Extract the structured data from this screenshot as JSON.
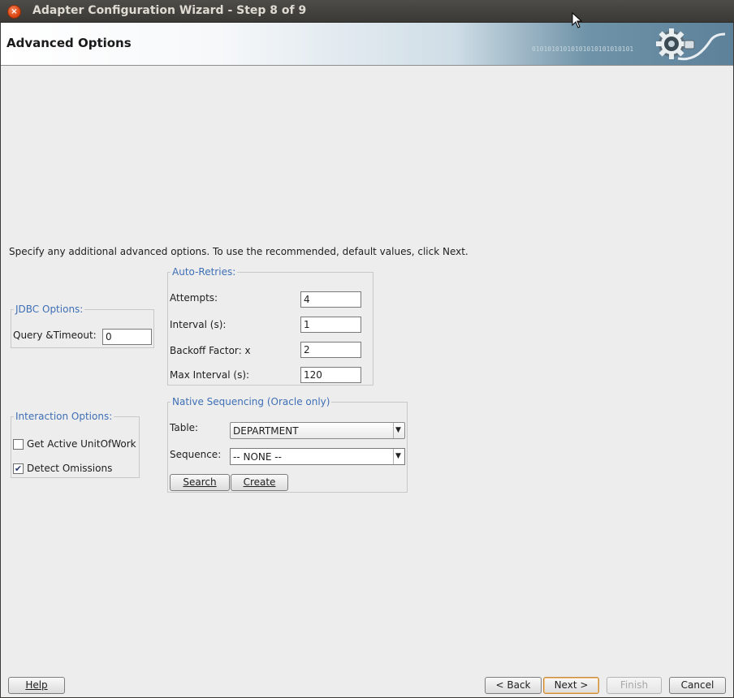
{
  "window": {
    "title": "Adapter Configuration Wizard - Step 8 of 9",
    "close_glyph": "×"
  },
  "banner": {
    "title": "Advanced Options",
    "binary_text": "01010101010101010101010101",
    "icon": "gear-plug-icon"
  },
  "intro_text": "Specify any additional advanced options.  To use the recommended, default values, click Next.",
  "auto_retries": {
    "legend": "Auto-Retries:",
    "attempts_label": "Attempts:",
    "attempts_value": "4",
    "interval_label": "Interval (s):",
    "interval_value": "1",
    "backoff_label": "Backoff Factor: x",
    "backoff_value": "2",
    "max_interval_label": "Max Interval (s):",
    "max_interval_value": "120"
  },
  "jdbc": {
    "legend": "JDBC Options:",
    "query_timeout_label": "Query &Timeout:",
    "query_timeout_value": "0"
  },
  "interaction": {
    "legend": "Interaction Options:",
    "get_active_label": "Get Active UnitOfWork",
    "get_active_checked": false,
    "detect_omissions_label": "Detect Omissions",
    "detect_omissions_checked": true,
    "check_glyph": "✔"
  },
  "native_sequencing": {
    "legend": "Native Sequencing (Oracle only)",
    "table_label": "Table:",
    "table_value": "DEPARTMENT",
    "sequence_label": "Sequence:",
    "sequence_value": "-- NONE --",
    "search_label": "Search",
    "create_label": "Create",
    "dropdown_glyph": "▼"
  },
  "footer": {
    "help_label": "Help",
    "back_label": "< Back",
    "next_label": "Next >",
    "finish_label": "Finish",
    "cancel_label": "Cancel"
  }
}
